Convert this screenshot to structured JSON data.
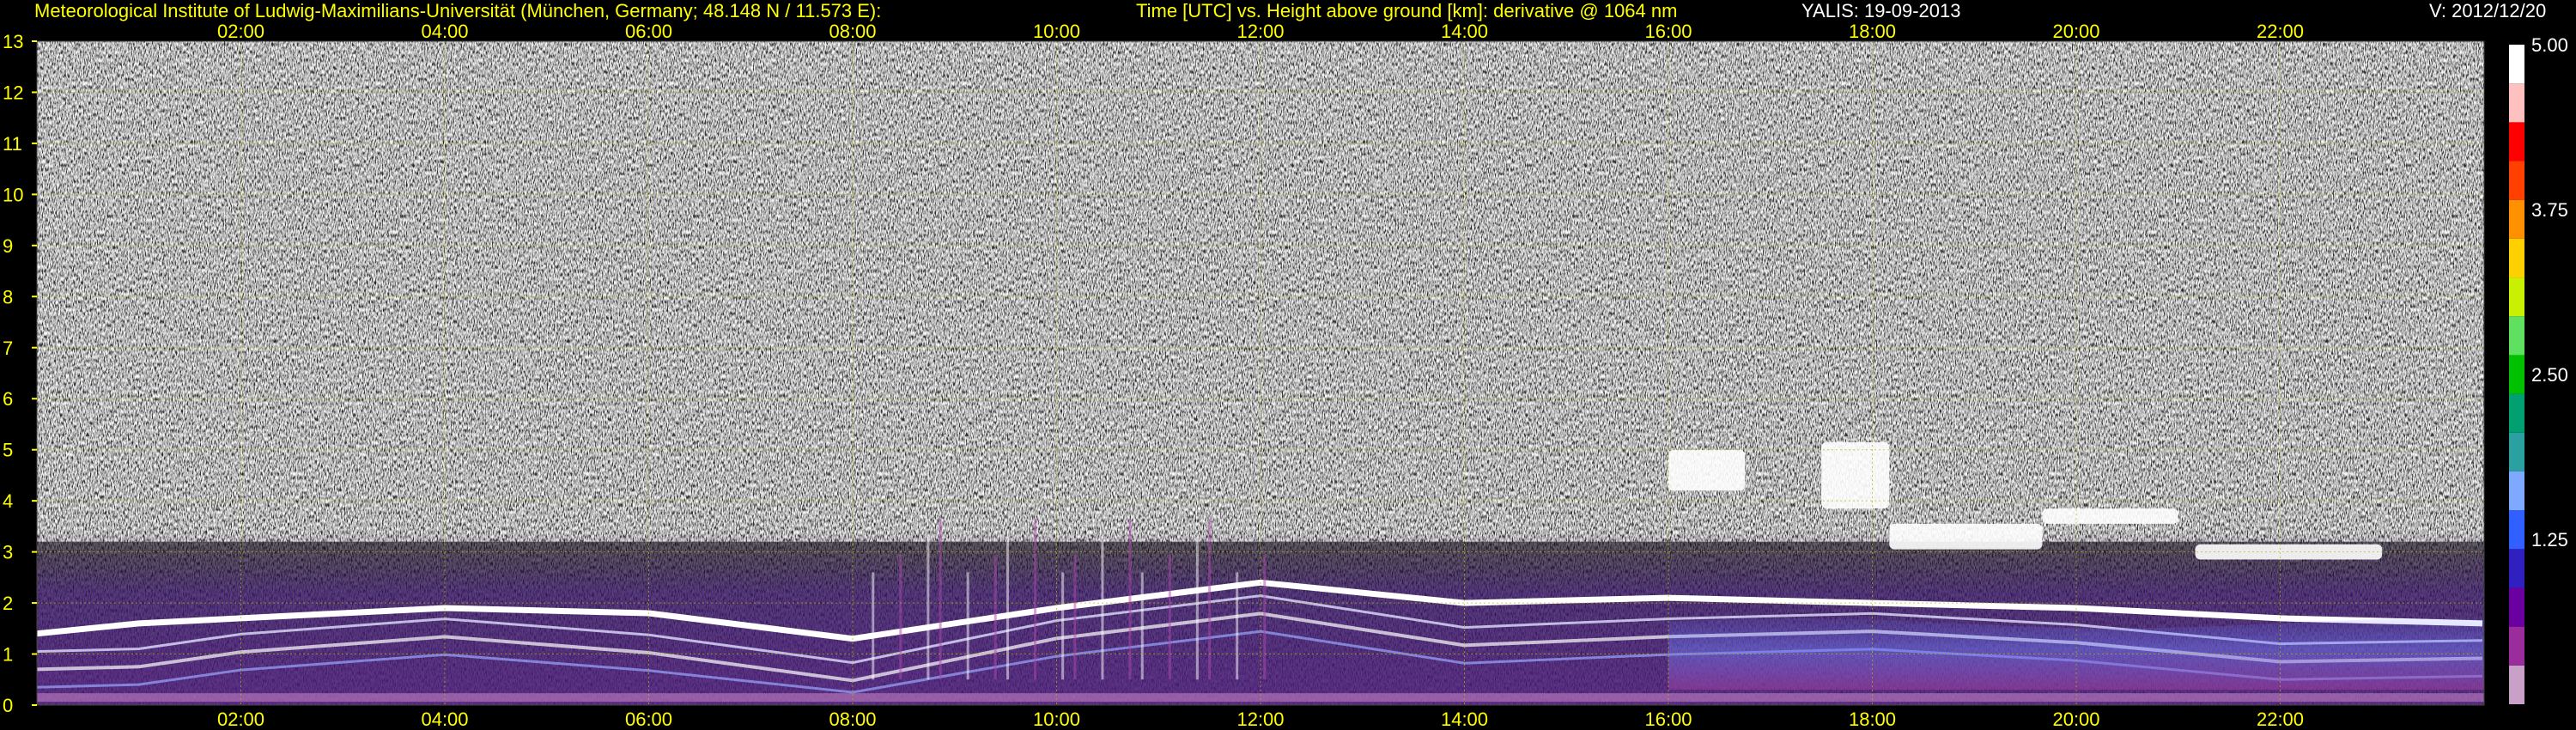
{
  "header": {
    "institute": "Meteorological Institute of Ludwig-Maximilians-Universität (München, Germany; 48.148 N / 11.573 E):",
    "description": "Time [UTC] vs. Height above ground [km]: derivative @ 1064 nm",
    "instrument_date": "YALIS: 19-09-2013",
    "version": "V: 2012/12/20"
  },
  "chart_data": {
    "type": "heatmap",
    "x_axis": {
      "ticks": [
        "02:00",
        "04:00",
        "06:00",
        "08:00",
        "10:00",
        "12:00",
        "14:00",
        "16:00",
        "18:00",
        "20:00",
        "22:00"
      ],
      "range_hours": [
        0,
        24
      ]
    },
    "y_axis": {
      "ticks": [
        "0",
        "1",
        "2",
        "3",
        "4",
        "5",
        "6",
        "7",
        "8",
        "9",
        "10",
        "11",
        "12",
        "13"
      ],
      "range_km": [
        0,
        13
      ]
    },
    "colorbar": {
      "ticks": [
        "1.25",
        "2.50",
        "3.75",
        "5.00"
      ],
      "range": [
        0,
        5
      ],
      "stops": [
        "#c8a0c8",
        "#9b2c9b",
        "#6a00a0",
        "#3020c0",
        "#3060ff",
        "#7fa8ff",
        "#2aa0a0",
        "#00a070",
        "#00c000",
        "#60e060",
        "#c8f000",
        "#ffd000",
        "#ff9000",
        "#ff4000",
        "#ff0000",
        "#ffc0c0",
        "#ffffff"
      ]
    },
    "grid": true,
    "features": {
      "boundary_layer_top_km": [
        {
          "time": "00:00",
          "h": 1.4
        },
        {
          "time": "01:00",
          "h": 1.6
        },
        {
          "time": "02:00",
          "h": 1.7
        },
        {
          "time": "04:00",
          "h": 1.9
        },
        {
          "time": "06:00",
          "h": 1.8
        },
        {
          "time": "08:00",
          "h": 1.3
        },
        {
          "time": "10:00",
          "h": 1.9
        },
        {
          "time": "12:00",
          "h": 2.4
        },
        {
          "time": "14:00",
          "h": 2.0
        },
        {
          "time": "16:00",
          "h": 2.1
        },
        {
          "time": "18:00",
          "h": 2.0
        },
        {
          "time": "20:00",
          "h": 1.9
        },
        {
          "time": "22:00",
          "h": 1.7
        },
        {
          "time": "23:59",
          "h": 1.6
        }
      ],
      "cloud_layers": [
        {
          "start": "16:00",
          "end": "16:45",
          "h_km": 4.6,
          "thickness_km": 0.8
        },
        {
          "start": "17:30",
          "end": "18:10",
          "h_km": 4.5,
          "thickness_km": 1.3
        },
        {
          "start": "18:10",
          "end": "19:40",
          "h_km": 3.3,
          "thickness_km": 0.5
        },
        {
          "start": "19:40",
          "end": "21:00",
          "h_km": 3.7,
          "thickness_km": 0.3
        },
        {
          "start": "21:10",
          "end": "23:00",
          "h_km": 3.0,
          "thickness_km": 0.3
        }
      ]
    }
  }
}
